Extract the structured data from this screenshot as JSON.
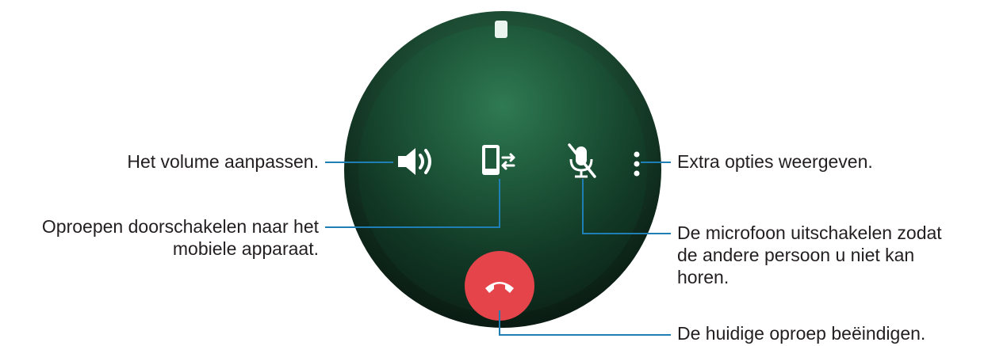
{
  "annotations": {
    "volume": "Het volume aanpassen.",
    "transfer": [
      "Oproepen doorschakelen naar het",
      "mobiele apparaat."
    ],
    "more_options": "Extra opties weergeven.",
    "mute": [
      "De microfoon uitschakelen zodat",
      "de andere persoon u niet kan",
      "horen."
    ],
    "end_call": "De huidige oproep beëindigen."
  },
  "icons": {
    "volume": "volume-icon",
    "transfer": "transfer-to-phone-icon",
    "mute": "mute-microphone-icon",
    "more": "more-options-icon",
    "end_call": "end-call-icon",
    "device": "phone-device-icon"
  },
  "colors": {
    "leader_line": "#1f7fb4",
    "end_call_button": "#e6444b",
    "watch_background": "#1c4c33"
  }
}
